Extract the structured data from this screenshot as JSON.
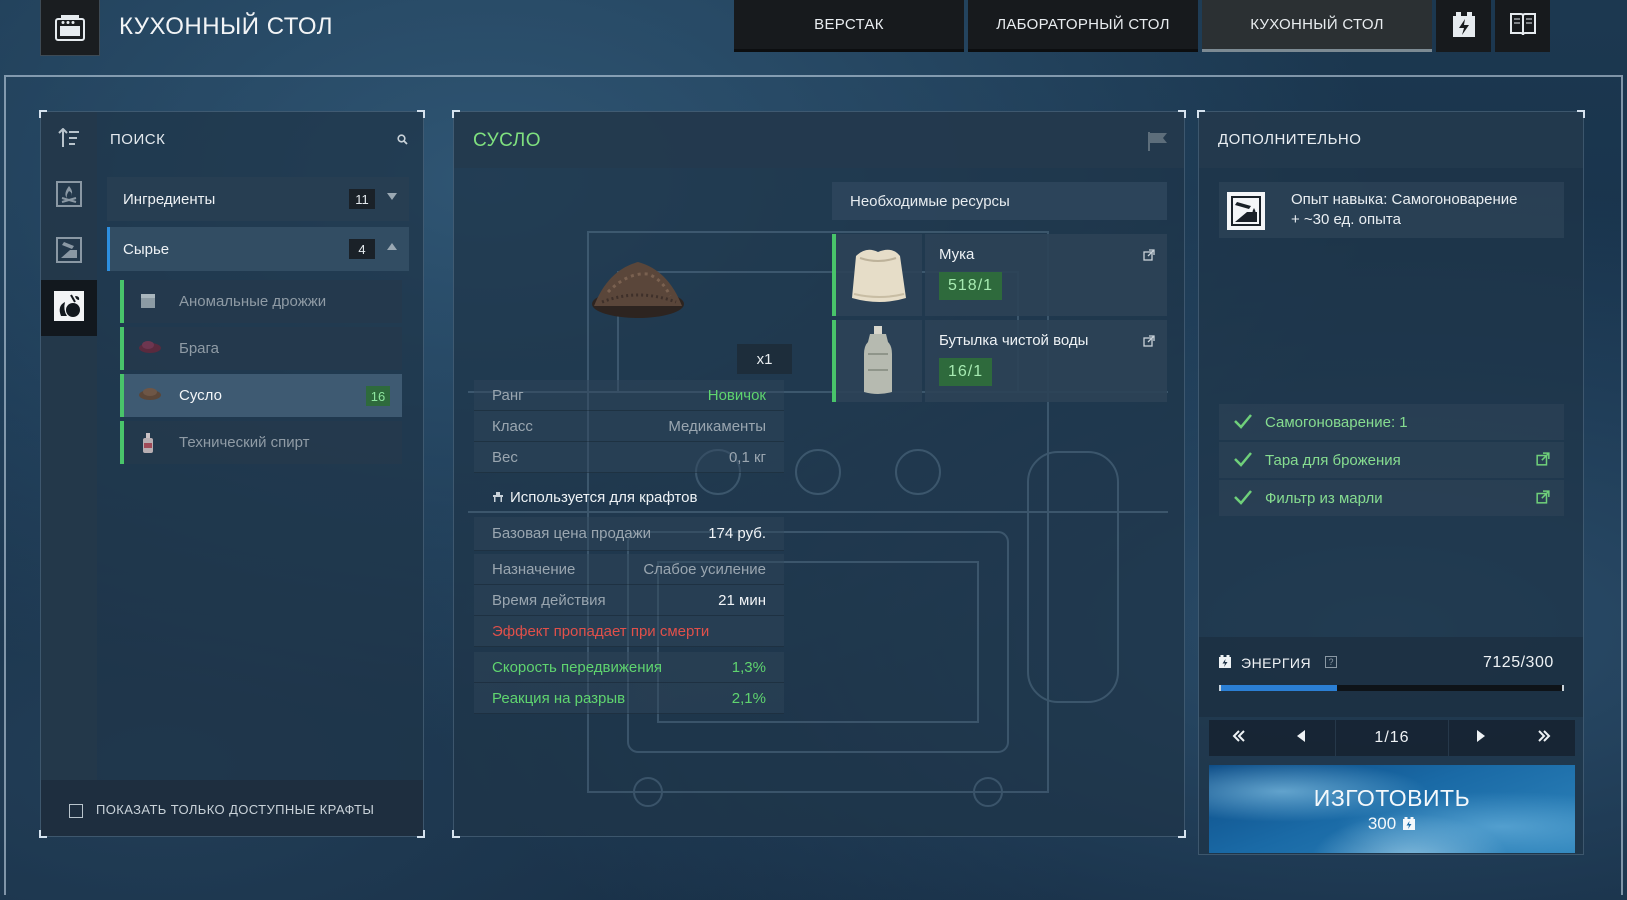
{
  "header": {
    "title": "КУХОННЫЙ СТОЛ",
    "tabs": [
      {
        "label": "ВЕРСТАК",
        "active": false
      },
      {
        "label": "ЛАБОРАТОРНЫЙ СТОЛ",
        "active": false
      },
      {
        "label": "КУХОННЫЙ СТОЛ",
        "active": true
      }
    ],
    "icons": [
      "battery-icon",
      "book-icon"
    ]
  },
  "left": {
    "search_label": "ПОИСК",
    "categories": [
      {
        "label": "Ингредиенты",
        "count": "11",
        "expanded": false
      },
      {
        "label": "Сырье",
        "count": "4",
        "expanded": true
      }
    ],
    "items": [
      {
        "label": "Аномальные дрожжи",
        "badge": ""
      },
      {
        "label": "Брага",
        "badge": ""
      },
      {
        "label": "Сусло",
        "badge": "16",
        "selected": true
      },
      {
        "label": "Технический спирт",
        "badge": ""
      }
    ],
    "only_available_label": "ПОКАЗАТЬ ТОЛЬКО ДОСТУПНЫЕ КРАФТЫ",
    "only_available_checked": false
  },
  "recipe": {
    "title": "СУСЛО",
    "quantity": "x1",
    "stats": [
      {
        "label": "Ранг",
        "value": "Новичок"
      },
      {
        "label": "Класс",
        "value": "Медикаменты"
      },
      {
        "label": "Вес",
        "value": "0,1 кг"
      }
    ],
    "used_for": "Используется для крафтов",
    "base_price_label": "Базовая цена продажи",
    "base_price": "174 руб.",
    "purpose_label": "Назначение",
    "purpose": "Слабое усиление",
    "duration_label": "Время действия",
    "duration": "21 мин",
    "death_warning": "Эффект пропадает при смерти",
    "effects": [
      {
        "label": "Скорость передвижения",
        "value": "1,3%"
      },
      {
        "label": "Реакция на разрыв",
        "value": "2,1%"
      }
    ],
    "resources_title": "Необходимые ресурсы",
    "resources": [
      {
        "name": "Мука",
        "count": "518/1"
      },
      {
        "name": "Бутылка чистой воды",
        "count": "16/1"
      }
    ]
  },
  "extra": {
    "title": "ДОПОЛНИТЕЛЬНО",
    "skill_line1": "Опыт навыка: Самогоноварение",
    "skill_line2": "+ ~30 ед. опыта",
    "requirements": [
      {
        "label": "Самогоноварение: 1",
        "link": false
      },
      {
        "label": "Тара для брожения",
        "link": true
      },
      {
        "label": "Фильтр из марли",
        "link": true
      }
    ],
    "energy_label": "ЭНЕРГИЯ",
    "energy_help": "?",
    "energy_value": "7125/300",
    "energy_fill_fraction": 0.34,
    "pager": "1/16",
    "craft_label": "ИЗГОТОВИТЬ",
    "craft_cost": "300"
  },
  "colors": {
    "accent_green": "#5fd46f",
    "accent_blue": "#2b7fd4",
    "warning_red": "#e0504a"
  }
}
